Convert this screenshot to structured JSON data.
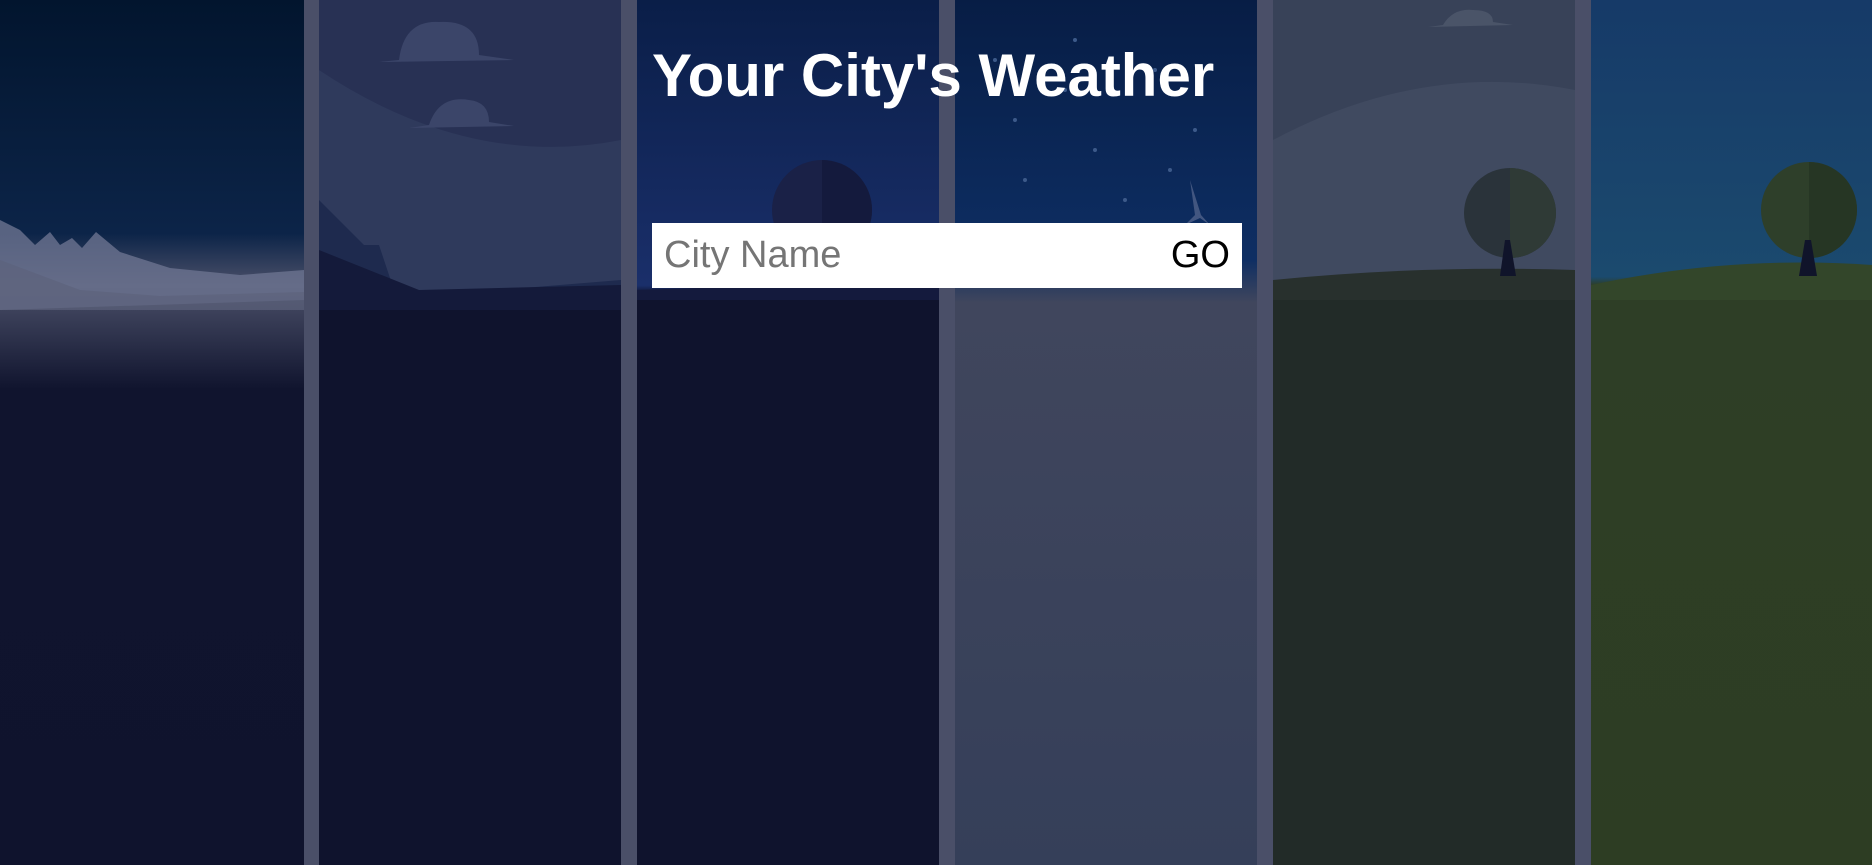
{
  "page": {
    "title": "Your City's Weather"
  },
  "search": {
    "placeholder": "City Name",
    "value": "",
    "button_label": "GO"
  },
  "backgrounds": [
    {
      "scene": "night-mountains"
    },
    {
      "scene": "night-hills-clouds"
    },
    {
      "scene": "night-moon"
    },
    {
      "scene": "night-snow"
    },
    {
      "scene": "cloudy-day-tree"
    },
    {
      "scene": "day-tree"
    }
  ],
  "colors": {
    "title_text": "#ffffff",
    "input_background": "#ffffff",
    "panel_gap": "#4a4f68"
  }
}
